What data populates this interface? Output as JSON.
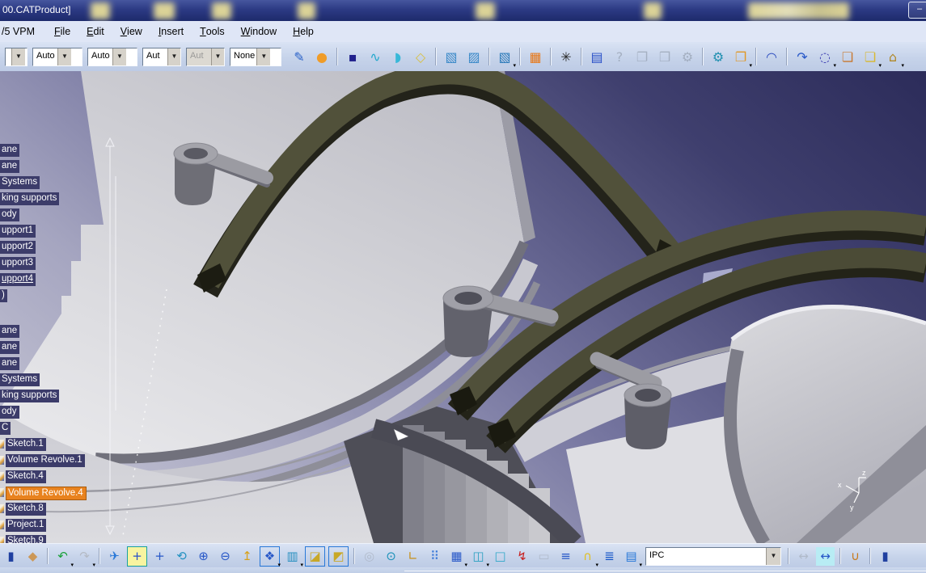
{
  "window": {
    "title": "00.CATProduct]",
    "minimize_glyph": "–"
  },
  "menu": {
    "items": [
      {
        "label": "/5 VPM",
        "mnemonic": false
      },
      {
        "label": "File",
        "mnemonic": true
      },
      {
        "label": "Edit",
        "mnemonic": true
      },
      {
        "label": "View",
        "mnemonic": true
      },
      {
        "label": "Insert",
        "mnemonic": true
      },
      {
        "label": "Tools",
        "mnemonic": true
      },
      {
        "label": "Window",
        "mnemonic": true
      },
      {
        "label": "Help",
        "mnemonic": true
      }
    ]
  },
  "top_toolbar": {
    "combos": [
      {
        "value": "",
        "width": 26,
        "cut": true,
        "disabled": false
      },
      {
        "value": "Auto",
        "width": 60,
        "disabled": false
      },
      {
        "value": "Auto",
        "width": 60,
        "disabled": false
      },
      {
        "value": "Aut",
        "width": 46,
        "disabled": false
      },
      {
        "value": "Aut",
        "width": 46,
        "disabled": true
      },
      {
        "value": "None",
        "width": 62,
        "disabled": false
      }
    ],
    "icons": [
      {
        "name": "paintbrush-icon",
        "glyph": "✎",
        "color": "#2a62c8"
      },
      {
        "name": "magic-sphere-icon",
        "glyph": "●",
        "color": "#f09c28"
      },
      {
        "name": "point-icon",
        "glyph": "▪",
        "color": "#20208c",
        "sep": true
      },
      {
        "name": "spline-icon",
        "glyph": "∿",
        "color": "#22a8cc"
      },
      {
        "name": "surface-patch-icon",
        "glyph": "◗",
        "color": "#38b8d8"
      },
      {
        "name": "extrude-face-icon",
        "glyph": "◇",
        "color": "#d8c040"
      },
      {
        "name": "select-face-icon",
        "glyph": "▧",
        "color": "#3888c8",
        "sep": true
      },
      {
        "name": "select-edge-icon",
        "glyph": "▨",
        "color": "#3888c8"
      },
      {
        "name": "select-body-icon",
        "glyph": "▧",
        "color": "#2878b8",
        "dd": true,
        "sep": true
      },
      {
        "name": "grid-orange-icon",
        "glyph": "▦",
        "color": "#e87818",
        "sep": true
      },
      {
        "name": "splatter-icon",
        "glyph": "✳",
        "color": "#2a2a2a",
        "sep": true
      },
      {
        "name": "form-edit-icon",
        "glyph": "▤",
        "color": "#2a50c8",
        "sep": true
      },
      {
        "name": "whats-this-icon",
        "glyph": "?",
        "color": "#808a98",
        "disabled": true
      },
      {
        "name": "window-copy-icon",
        "glyph": "❐",
        "color": "#808a98",
        "disabled": true
      },
      {
        "name": "window-grid-icon",
        "glyph": "❒",
        "color": "#808a98",
        "disabled": true
      },
      {
        "name": "gears-gray-icon",
        "glyph": "⚙",
        "color": "#808a98",
        "disabled": true
      },
      {
        "name": "gears-icon",
        "glyph": "⚙",
        "color": "#2090b0",
        "sep": true
      },
      {
        "name": "catalog-icon",
        "glyph": "❐",
        "color": "#e09828",
        "dd": true
      },
      {
        "name": "graph-curve-icon",
        "glyph": "◠",
        "color": "#3050c0",
        "sep": true
      },
      {
        "name": "repeat-xn-icon",
        "glyph": "↷",
        "color": "#2858c8",
        "sep": true
      },
      {
        "name": "update-cycle-icon",
        "glyph": "◌",
        "color": "#3838b0",
        "dd": true
      },
      {
        "name": "clipboard-icon",
        "glyph": "❏",
        "color": "#c87830"
      },
      {
        "name": "layers-stack-icon",
        "glyph": "❏",
        "color": "#d8b830",
        "dd": true
      },
      {
        "name": "factory-icon",
        "glyph": "⌂",
        "color": "#b08828",
        "dd": true
      }
    ]
  },
  "bottom_toolbar": {
    "icons_left": [
      {
        "name": "edge-partial-icon",
        "glyph": "▮",
        "color": "#2040a0"
      },
      {
        "name": "exit-workbench-icon",
        "glyph": "◆",
        "color": "#cc9858"
      },
      {
        "name": "undo-icon",
        "glyph": "↶",
        "color": "#18a038",
        "dd": true,
        "sep": true
      },
      {
        "name": "redo-icon",
        "glyph": "↷",
        "color": "#b4bac4",
        "dd": true
      },
      {
        "name": "fly-mode-icon",
        "glyph": "✈",
        "color": "#2878d8",
        "sep": true
      },
      {
        "name": "fit-all-icon",
        "glyph": "+",
        "color": "#2850c8",
        "bg": "#f8f4a0",
        "border": "#18a0a0"
      },
      {
        "name": "pan-icon",
        "glyph": "+",
        "color": "#2858c8"
      },
      {
        "name": "rotate-icon",
        "glyph": "⟲",
        "color": "#2090c0"
      },
      {
        "name": "zoom-in-icon",
        "glyph": "⊕",
        "color": "#2858c8"
      },
      {
        "name": "zoom-out-icon",
        "glyph": "⊖",
        "color": "#2858c8"
      },
      {
        "name": "normal-view-icon",
        "glyph": "↥",
        "color": "#d8a018"
      },
      {
        "name": "multi-view-icon",
        "glyph": "❖",
        "color": "#2858c8",
        "border": "#2878d8",
        "dd": true
      },
      {
        "name": "render-style-icon",
        "glyph": "▥",
        "color": "#2890c0",
        "dd": true
      },
      {
        "name": "iso-view-icon",
        "glyph": "◪",
        "color": "#c8a828",
        "border": "#2878d8"
      },
      {
        "name": "iso-view-alt-icon",
        "glyph": "◩",
        "color": "#c8a828",
        "border": "#2878d8"
      },
      {
        "name": "spiral-gray-icon",
        "glyph": "◎",
        "color": "#9aa2ac",
        "disabled": true,
        "sep": true
      },
      {
        "name": "select-hand-icon",
        "glyph": "⊙",
        "color": "#1890b8"
      },
      {
        "name": "axis-system-icon",
        "glyph": "∟",
        "color": "#c89018"
      },
      {
        "name": "catgraph-icon",
        "glyph": "⠿",
        "color": "#3878d8"
      },
      {
        "name": "grid-icon",
        "glyph": "▦",
        "color": "#2858c8",
        "dd": true
      },
      {
        "name": "revolve-band-icon",
        "glyph": "◫",
        "color": "#28a0c0",
        "dd": true
      },
      {
        "name": "cube-icon",
        "glyph": "□",
        "color": "#30a8c8"
      },
      {
        "name": "circuit-icon",
        "glyph": "↯",
        "color": "#c82020"
      },
      {
        "name": "machine-gray-icon",
        "glyph": "▭",
        "color": "#9aa2ac",
        "disabled": true
      },
      {
        "name": "tree-structure-icon",
        "glyph": "≡",
        "color": "#2858c8"
      },
      {
        "name": "dome-icon",
        "glyph": "∩",
        "color": "#e0c020",
        "dd": true
      },
      {
        "name": "list-blue-icon",
        "glyph": "≣",
        "color": "#1858c8"
      },
      {
        "name": "book-icon",
        "glyph": "▤",
        "color": "#2878d8",
        "dd": true
      }
    ],
    "combo_value": "IPC",
    "icons_right": [
      {
        "name": "dim-gray-icon",
        "glyph": "↔",
        "color": "#9aa2ac",
        "disabled": true,
        "sep": true
      },
      {
        "name": "dim-measure-icon",
        "glyph": "↔",
        "color": "#2858c8",
        "bg": "#b8ecf4"
      },
      {
        "name": "clamp-icon",
        "glyph": "∪",
        "color": "#c87818",
        "sep": true
      },
      {
        "name": "partial-right-icon",
        "glyph": "▮",
        "color": "#2040a0",
        "sep": true
      }
    ]
  },
  "tree": {
    "group1": [
      {
        "label": "ane"
      },
      {
        "label": "ane"
      },
      {
        "label": "Systems"
      },
      {
        "label": "king supports"
      },
      {
        "label": "ody"
      },
      {
        "label": "upport1"
      },
      {
        "label": "upport2"
      },
      {
        "label": "upport3"
      },
      {
        "label": "upport4",
        "underlined": true
      },
      {
        "label": ")"
      }
    ],
    "group2": [
      {
        "label": "ane"
      },
      {
        "label": "ane"
      },
      {
        "label": "ane"
      },
      {
        "label": "Systems"
      },
      {
        "label": "king supports"
      },
      {
        "label": "ody"
      },
      {
        "label": "C"
      },
      {
        "label": "Sketch.1",
        "sliver": true
      },
      {
        "label": "Volume Revolve.1",
        "sliver": true
      },
      {
        "label": "Sketch.4",
        "sliver": true
      },
      {
        "label": "Volume Revolve.4",
        "selected": true,
        "sliver": true
      },
      {
        "label": "Sketch.8",
        "sliver": true
      },
      {
        "label": "Project.1",
        "sliver": true
      },
      {
        "label": "Sketch.9",
        "sliver": true
      }
    ]
  },
  "viewport": {
    "axis": {
      "x": "x",
      "y": "y",
      "z": "z"
    }
  },
  "colors": {
    "titlebar": "#2c3a84",
    "toolbar_bg": "#c6d3ea",
    "tree_label_bg": "#3c3c6a",
    "tree_selected_bg": "#e8821e",
    "strap_olive": "#51513a",
    "strap_dark": "#23231a",
    "casing_light": "#d8d8dd",
    "background_top": "#2e2e5c",
    "background_bottom": "#b5b5c8"
  }
}
